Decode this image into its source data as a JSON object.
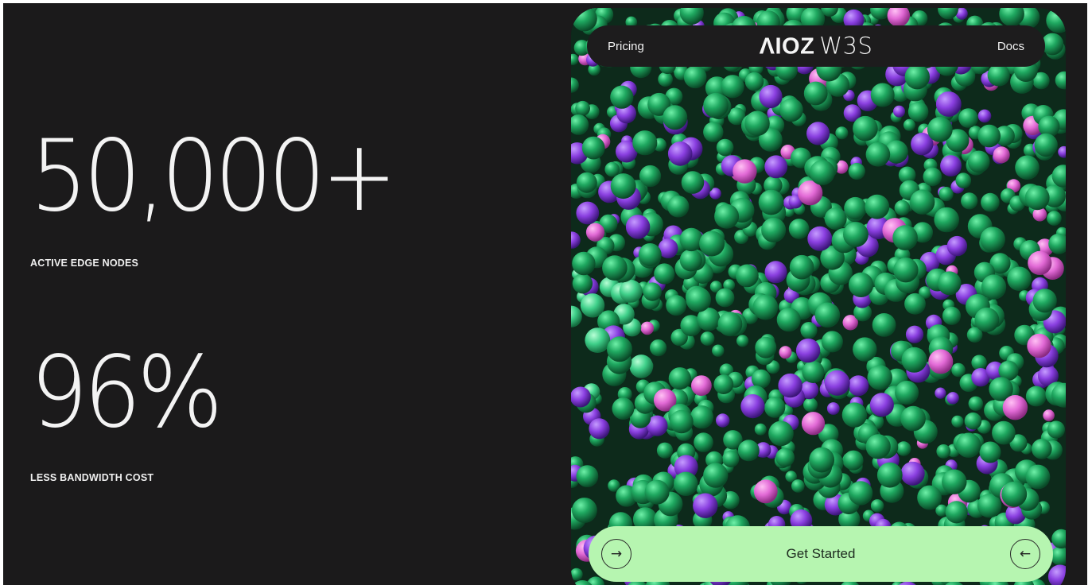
{
  "stats": [
    {
      "value": "50,000+",
      "label": "ACTIVE EDGE NODES"
    },
    {
      "value": "96%",
      "label": "LESS BANDWIDTH COST"
    }
  ],
  "nav": {
    "left_link": "Pricing",
    "logo_mark": "ΛIOZ",
    "logo_suffix": "W3S",
    "right_link": "Docs"
  },
  "cta": {
    "label": "Get Started",
    "left_icon": "arrow-right-icon",
    "right_icon": "arrow-left-icon"
  },
  "colors": {
    "background": "#1b1a1b",
    "text": "#f3f3f3",
    "cta_background": "#b6f5b0",
    "ball_green": "#1fa860",
    "ball_purple": "#8a3fe0",
    "ball_pink": "#e26ad6"
  }
}
